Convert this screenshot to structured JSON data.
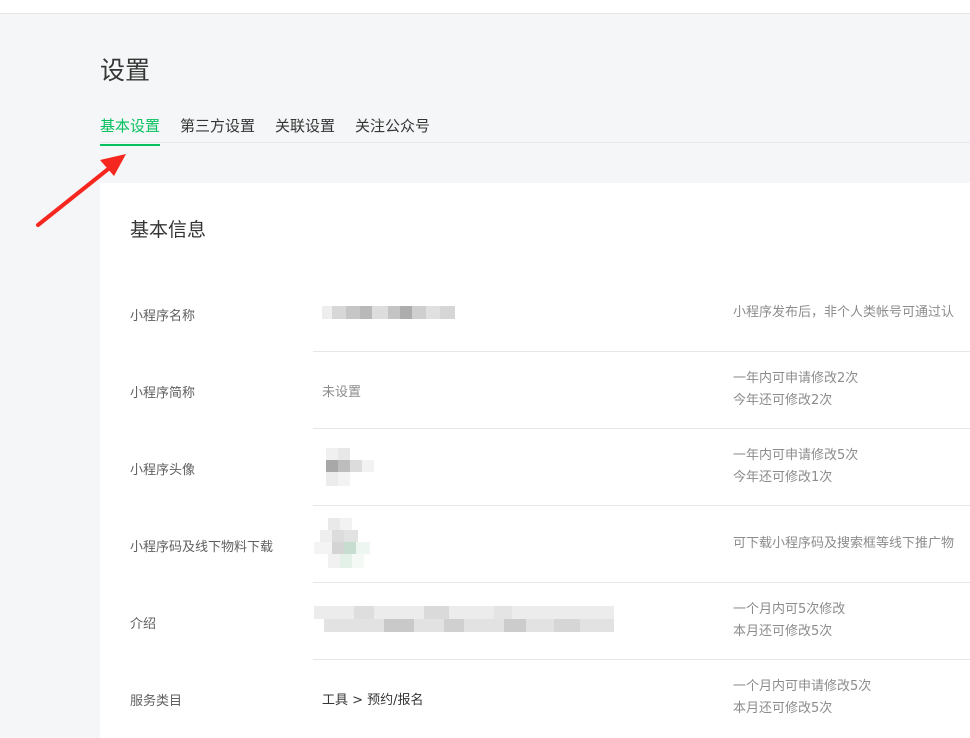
{
  "page": {
    "title": "设置",
    "tabs": [
      {
        "label": "基本设置",
        "active": true
      },
      {
        "label": "第三方设置",
        "active": false
      },
      {
        "label": "关联设置",
        "active": false
      },
      {
        "label": "关注公众号",
        "active": false
      }
    ]
  },
  "basic_info": {
    "title": "基本信息",
    "rows": [
      {
        "label": "小程序名称",
        "value": "",
        "hint_lines": [
          "小程序发布后，非个人类帐号可通过认"
        ]
      },
      {
        "label": "小程序简称",
        "value": "未设置",
        "hint_lines": [
          "一年内可申请修改2次",
          "今年还可修改2次"
        ]
      },
      {
        "label": "小程序头像",
        "value": "",
        "hint_lines": [
          "一年内可申请修改5次",
          "今年还可修改1次"
        ]
      },
      {
        "label": "小程序码及线下物料下载",
        "value": "",
        "hint_lines": [
          "可下载小程序码及搜索框等线下推广物"
        ]
      },
      {
        "label": "介绍",
        "value": "",
        "hint_lines": [
          "一个月内可5次修改",
          "本月还可修改5次"
        ]
      },
      {
        "label": "服务类目",
        "value": "工具 > 预约/报名",
        "hint_lines": [
          "一个月内可申请修改5次",
          "本月还可修改5次"
        ]
      }
    ]
  },
  "colors": {
    "accent": "#07c160",
    "annotation_arrow": "#f5271e"
  },
  "icons": {
    "annotation": "red-arrow-icon"
  }
}
